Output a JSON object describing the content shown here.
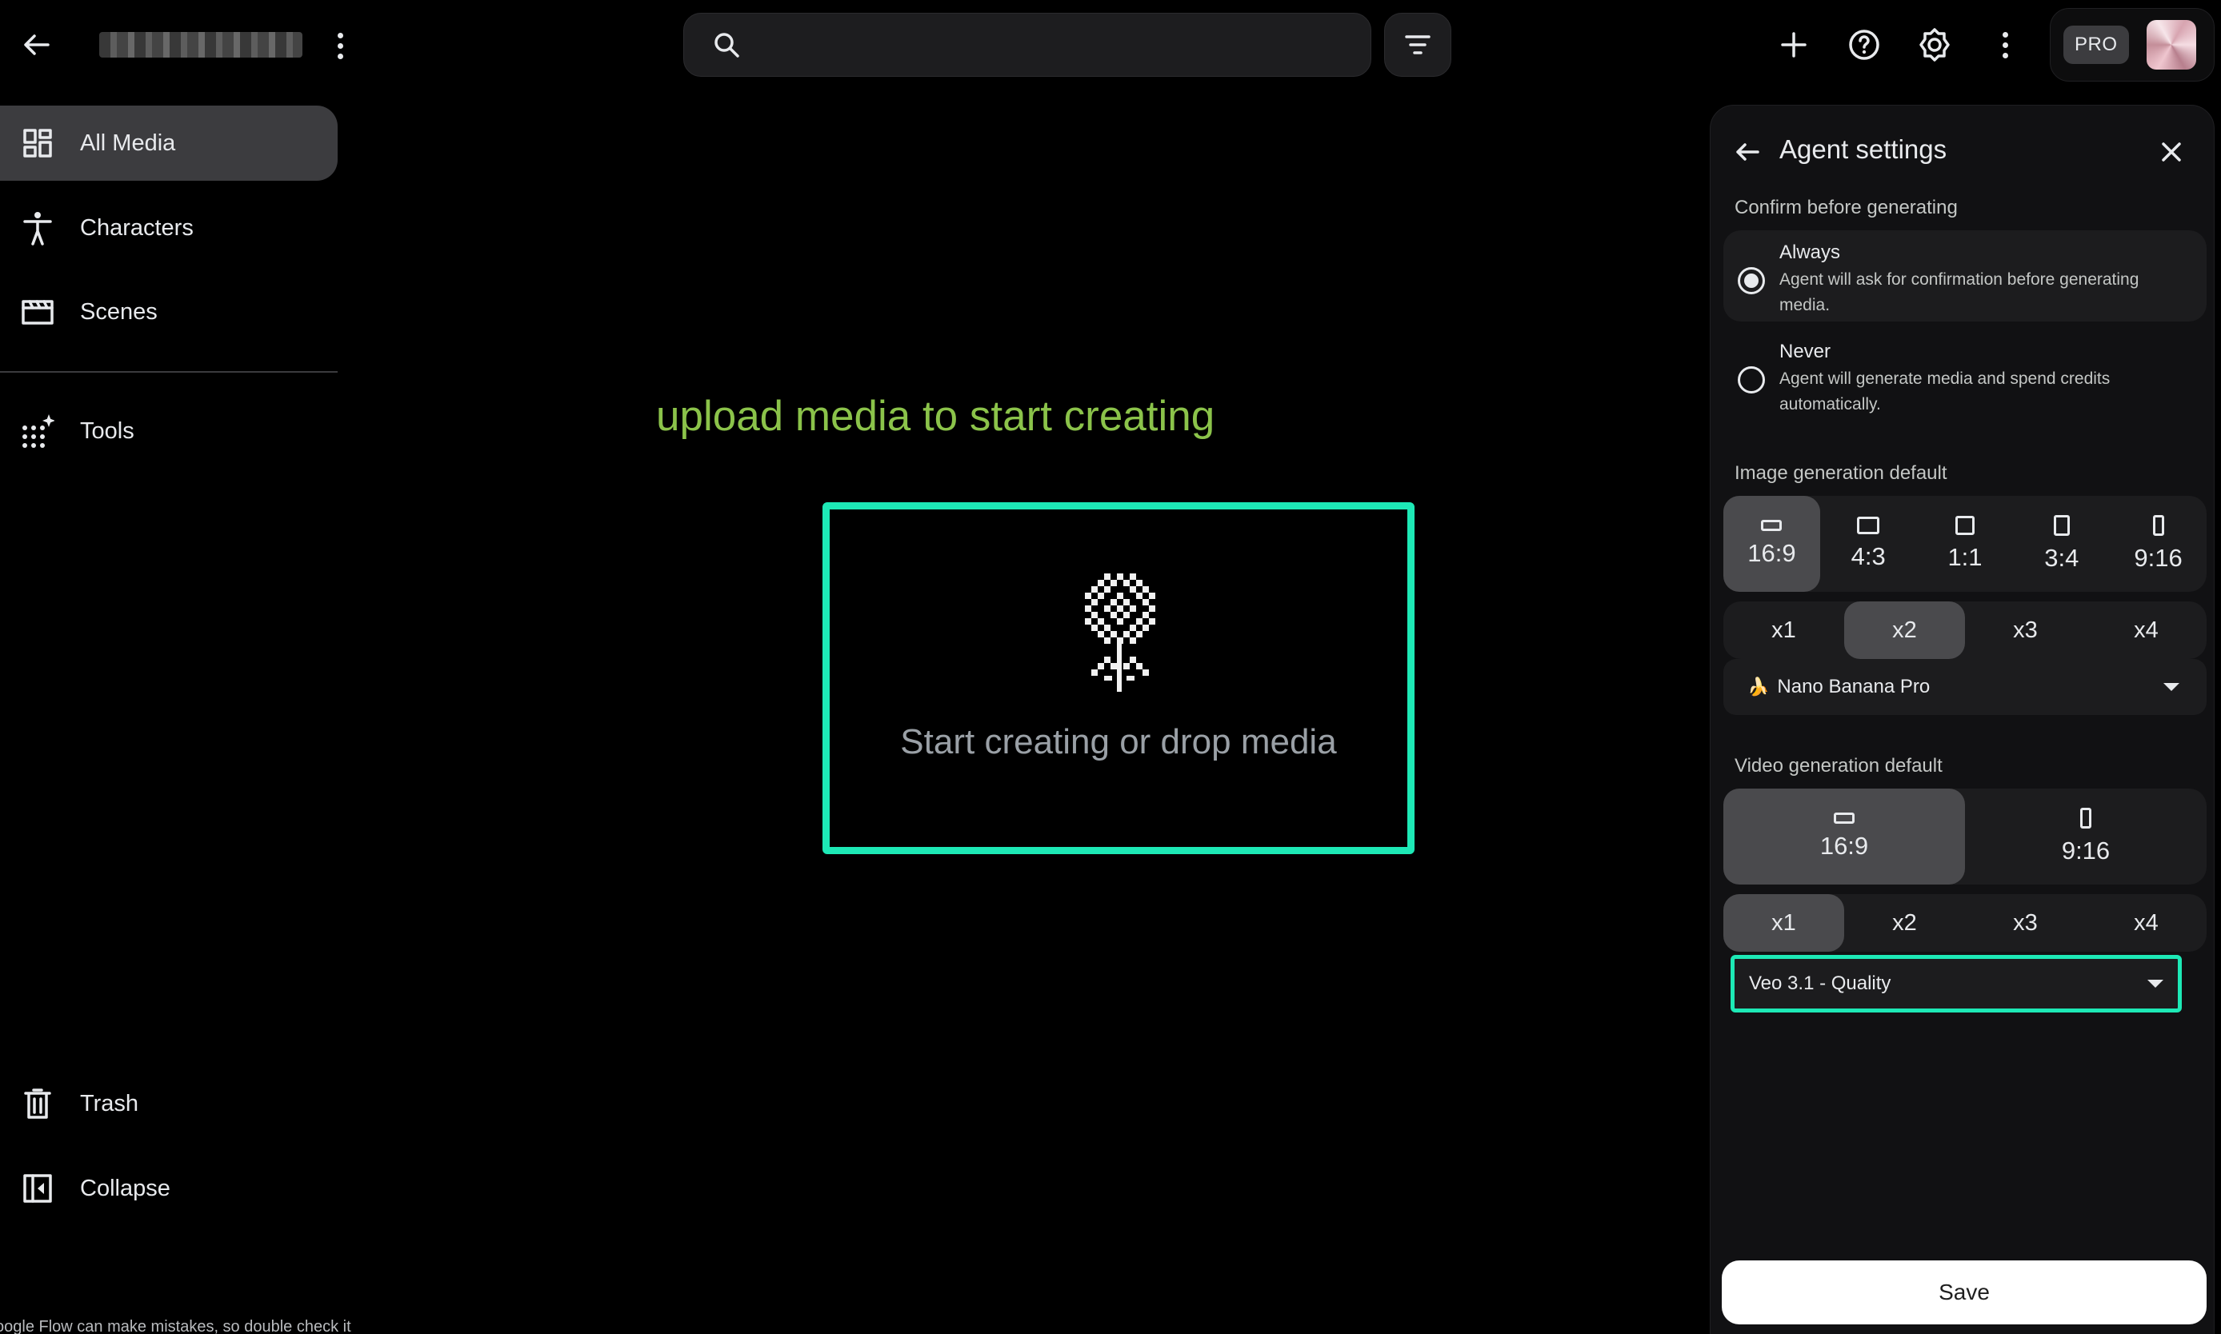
{
  "header": {
    "search_placeholder": "",
    "pro_badge": "PRO",
    "icons": [
      "arrow-back-icon",
      "more-vert-icon",
      "search-icon",
      "filter-icon",
      "add-icon",
      "help-icon",
      "settings-icon",
      "more-vert-icon"
    ]
  },
  "sidebar": {
    "items": [
      {
        "label": "All Media",
        "icon": "grid-icon"
      },
      {
        "label": "Characters",
        "icon": "person-icon"
      },
      {
        "label": "Scenes",
        "icon": "clapperboard-icon"
      },
      {
        "label": "Tools",
        "icon": "sparkle-grid-icon"
      }
    ],
    "bottom": [
      {
        "label": "Trash",
        "icon": "trash-icon"
      },
      {
        "label": "Collapse",
        "icon": "collapse-icon"
      }
    ],
    "footer_note": "oogle Flow can make mistakes, so double check it"
  },
  "main": {
    "hint": "upload media to start creating",
    "drop_label": "Start creating or drop media"
  },
  "agent_settings": {
    "title": "Agent settings",
    "confirm_label": "Confirm before generating",
    "options": [
      {
        "title": "Always",
        "desc": "Agent will ask for confirmation before generating media.",
        "selected": true
      },
      {
        "title": "Never",
        "desc": "Agent will generate media and spend credits automatically.",
        "selected": false
      }
    ],
    "image_label": "Image generation default",
    "image_ratios": [
      "16:9",
      "4:3",
      "1:1",
      "3:4",
      "9:16"
    ],
    "image_ratio_selected": "16:9",
    "image_counts": [
      "x1",
      "x2",
      "x3",
      "x4"
    ],
    "image_count_selected": "x2",
    "image_model": "Nano Banana Pro",
    "image_model_emoji": "🍌",
    "video_label": "Video generation default",
    "video_ratios": [
      "16:9",
      "9:16"
    ],
    "video_ratio_selected": "16:9",
    "video_counts": [
      "x1",
      "x2",
      "x3",
      "x4"
    ],
    "video_count_selected": "x1",
    "video_model": "Veo 3.1 - Quality",
    "save_label": "Save"
  },
  "colors": {
    "accent_teal": "#1de9b6",
    "hint_green": "#8bc34a",
    "background": "#000000",
    "panel": "#111113",
    "selected": "#4a4a4d"
  }
}
